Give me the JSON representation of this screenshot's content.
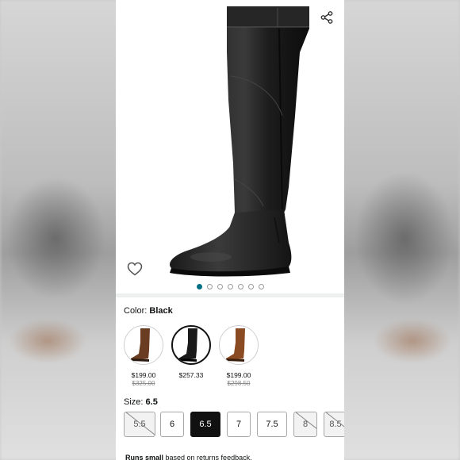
{
  "product": {
    "image_alt": "Black knee-high leather riding boot",
    "carousel": {
      "count": 7,
      "active_index": 0
    }
  },
  "color": {
    "label": "Color:",
    "selected": "Black",
    "options": [
      {
        "name": "Brown",
        "price": "$199.00",
        "was": "$325.00",
        "selected": false,
        "tone": "#6a3d22"
      },
      {
        "name": "Black",
        "price": "$257.33",
        "was": "",
        "selected": true,
        "tone": "#1a1a1a"
      },
      {
        "name": "Cognac",
        "price": "$199.00",
        "was": "$298.50",
        "selected": false,
        "tone": "#8a4a22"
      }
    ]
  },
  "size": {
    "label": "Size:",
    "selected": "6.5",
    "options": [
      {
        "label": "5.5",
        "state": "unavailable"
      },
      {
        "label": "6",
        "state": "available"
      },
      {
        "label": "6.5",
        "state": "selected"
      },
      {
        "label": "7",
        "state": "available"
      },
      {
        "label": "7.5",
        "state": "available"
      },
      {
        "label": "8",
        "state": "unavailable"
      },
      {
        "label": "8.5",
        "state": "unavailable"
      }
    ]
  },
  "fit_note": {
    "bold": "Runs small",
    "rest": " based on returns feedback."
  },
  "icons": {
    "share": "share-icon",
    "wishlist": "heart-icon"
  },
  "colors": {
    "accent": "#007185",
    "selected_size_bg": "#111111"
  }
}
